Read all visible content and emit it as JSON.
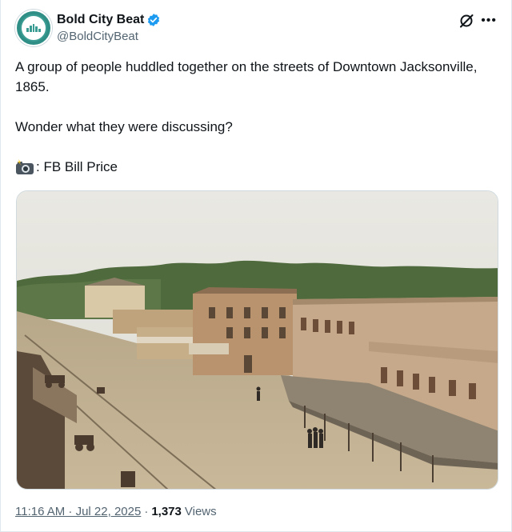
{
  "account": {
    "display_name": "Bold City Beat",
    "handle": "@BoldCityBeat",
    "avatar_icon": "bold-city-beat-logo",
    "verified_color": "#1d9bf0"
  },
  "tweet": {
    "line1": "A group of people huddled together on the streets of Downtown Jacksonville, 1865.",
    "line2": "Wonder what they were discussing?",
    "credit_emoji": "camera-with-flash",
    "credit": ": FB Bill Price"
  },
  "meta": {
    "time": "11:16 AM · Jul 22, 2025",
    "separator": "·",
    "views_count": "1,373",
    "views_label": "Views"
  }
}
